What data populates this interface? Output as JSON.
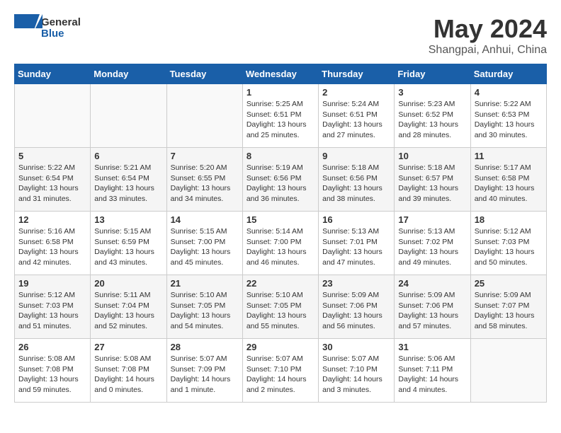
{
  "header": {
    "logo_general": "General",
    "logo_blue": "Blue",
    "month_title": "May 2024",
    "location": "Shangpai, Anhui, China"
  },
  "days_of_week": [
    "Sunday",
    "Monday",
    "Tuesday",
    "Wednesday",
    "Thursday",
    "Friday",
    "Saturday"
  ],
  "weeks": [
    [
      {
        "day": "",
        "info": ""
      },
      {
        "day": "",
        "info": ""
      },
      {
        "day": "",
        "info": ""
      },
      {
        "day": "1",
        "info": "Sunrise: 5:25 AM\nSunset: 6:51 PM\nDaylight: 13 hours\nand 25 minutes."
      },
      {
        "day": "2",
        "info": "Sunrise: 5:24 AM\nSunset: 6:51 PM\nDaylight: 13 hours\nand 27 minutes."
      },
      {
        "day": "3",
        "info": "Sunrise: 5:23 AM\nSunset: 6:52 PM\nDaylight: 13 hours\nand 28 minutes."
      },
      {
        "day": "4",
        "info": "Sunrise: 5:22 AM\nSunset: 6:53 PM\nDaylight: 13 hours\nand 30 minutes."
      }
    ],
    [
      {
        "day": "5",
        "info": "Sunrise: 5:22 AM\nSunset: 6:54 PM\nDaylight: 13 hours\nand 31 minutes."
      },
      {
        "day": "6",
        "info": "Sunrise: 5:21 AM\nSunset: 6:54 PM\nDaylight: 13 hours\nand 33 minutes."
      },
      {
        "day": "7",
        "info": "Sunrise: 5:20 AM\nSunset: 6:55 PM\nDaylight: 13 hours\nand 34 minutes."
      },
      {
        "day": "8",
        "info": "Sunrise: 5:19 AM\nSunset: 6:56 PM\nDaylight: 13 hours\nand 36 minutes."
      },
      {
        "day": "9",
        "info": "Sunrise: 5:18 AM\nSunset: 6:56 PM\nDaylight: 13 hours\nand 38 minutes."
      },
      {
        "day": "10",
        "info": "Sunrise: 5:18 AM\nSunset: 6:57 PM\nDaylight: 13 hours\nand 39 minutes."
      },
      {
        "day": "11",
        "info": "Sunrise: 5:17 AM\nSunset: 6:58 PM\nDaylight: 13 hours\nand 40 minutes."
      }
    ],
    [
      {
        "day": "12",
        "info": "Sunrise: 5:16 AM\nSunset: 6:58 PM\nDaylight: 13 hours\nand 42 minutes."
      },
      {
        "day": "13",
        "info": "Sunrise: 5:15 AM\nSunset: 6:59 PM\nDaylight: 13 hours\nand 43 minutes."
      },
      {
        "day": "14",
        "info": "Sunrise: 5:15 AM\nSunset: 7:00 PM\nDaylight: 13 hours\nand 45 minutes."
      },
      {
        "day": "15",
        "info": "Sunrise: 5:14 AM\nSunset: 7:00 PM\nDaylight: 13 hours\nand 46 minutes."
      },
      {
        "day": "16",
        "info": "Sunrise: 5:13 AM\nSunset: 7:01 PM\nDaylight: 13 hours\nand 47 minutes."
      },
      {
        "day": "17",
        "info": "Sunrise: 5:13 AM\nSunset: 7:02 PM\nDaylight: 13 hours\nand 49 minutes."
      },
      {
        "day": "18",
        "info": "Sunrise: 5:12 AM\nSunset: 7:03 PM\nDaylight: 13 hours\nand 50 minutes."
      }
    ],
    [
      {
        "day": "19",
        "info": "Sunrise: 5:12 AM\nSunset: 7:03 PM\nDaylight: 13 hours\nand 51 minutes."
      },
      {
        "day": "20",
        "info": "Sunrise: 5:11 AM\nSunset: 7:04 PM\nDaylight: 13 hours\nand 52 minutes."
      },
      {
        "day": "21",
        "info": "Sunrise: 5:10 AM\nSunset: 7:05 PM\nDaylight: 13 hours\nand 54 minutes."
      },
      {
        "day": "22",
        "info": "Sunrise: 5:10 AM\nSunset: 7:05 PM\nDaylight: 13 hours\nand 55 minutes."
      },
      {
        "day": "23",
        "info": "Sunrise: 5:09 AM\nSunset: 7:06 PM\nDaylight: 13 hours\nand 56 minutes."
      },
      {
        "day": "24",
        "info": "Sunrise: 5:09 AM\nSunset: 7:06 PM\nDaylight: 13 hours\nand 57 minutes."
      },
      {
        "day": "25",
        "info": "Sunrise: 5:09 AM\nSunset: 7:07 PM\nDaylight: 13 hours\nand 58 minutes."
      }
    ],
    [
      {
        "day": "26",
        "info": "Sunrise: 5:08 AM\nSunset: 7:08 PM\nDaylight: 13 hours\nand 59 minutes."
      },
      {
        "day": "27",
        "info": "Sunrise: 5:08 AM\nSunset: 7:08 PM\nDaylight: 14 hours\nand 0 minutes."
      },
      {
        "day": "28",
        "info": "Sunrise: 5:07 AM\nSunset: 7:09 PM\nDaylight: 14 hours\nand 1 minute."
      },
      {
        "day": "29",
        "info": "Sunrise: 5:07 AM\nSunset: 7:10 PM\nDaylight: 14 hours\nand 2 minutes."
      },
      {
        "day": "30",
        "info": "Sunrise: 5:07 AM\nSunset: 7:10 PM\nDaylight: 14 hours\nand 3 minutes."
      },
      {
        "day": "31",
        "info": "Sunrise: 5:06 AM\nSunset: 7:11 PM\nDaylight: 14 hours\nand 4 minutes."
      },
      {
        "day": "",
        "info": ""
      }
    ]
  ]
}
